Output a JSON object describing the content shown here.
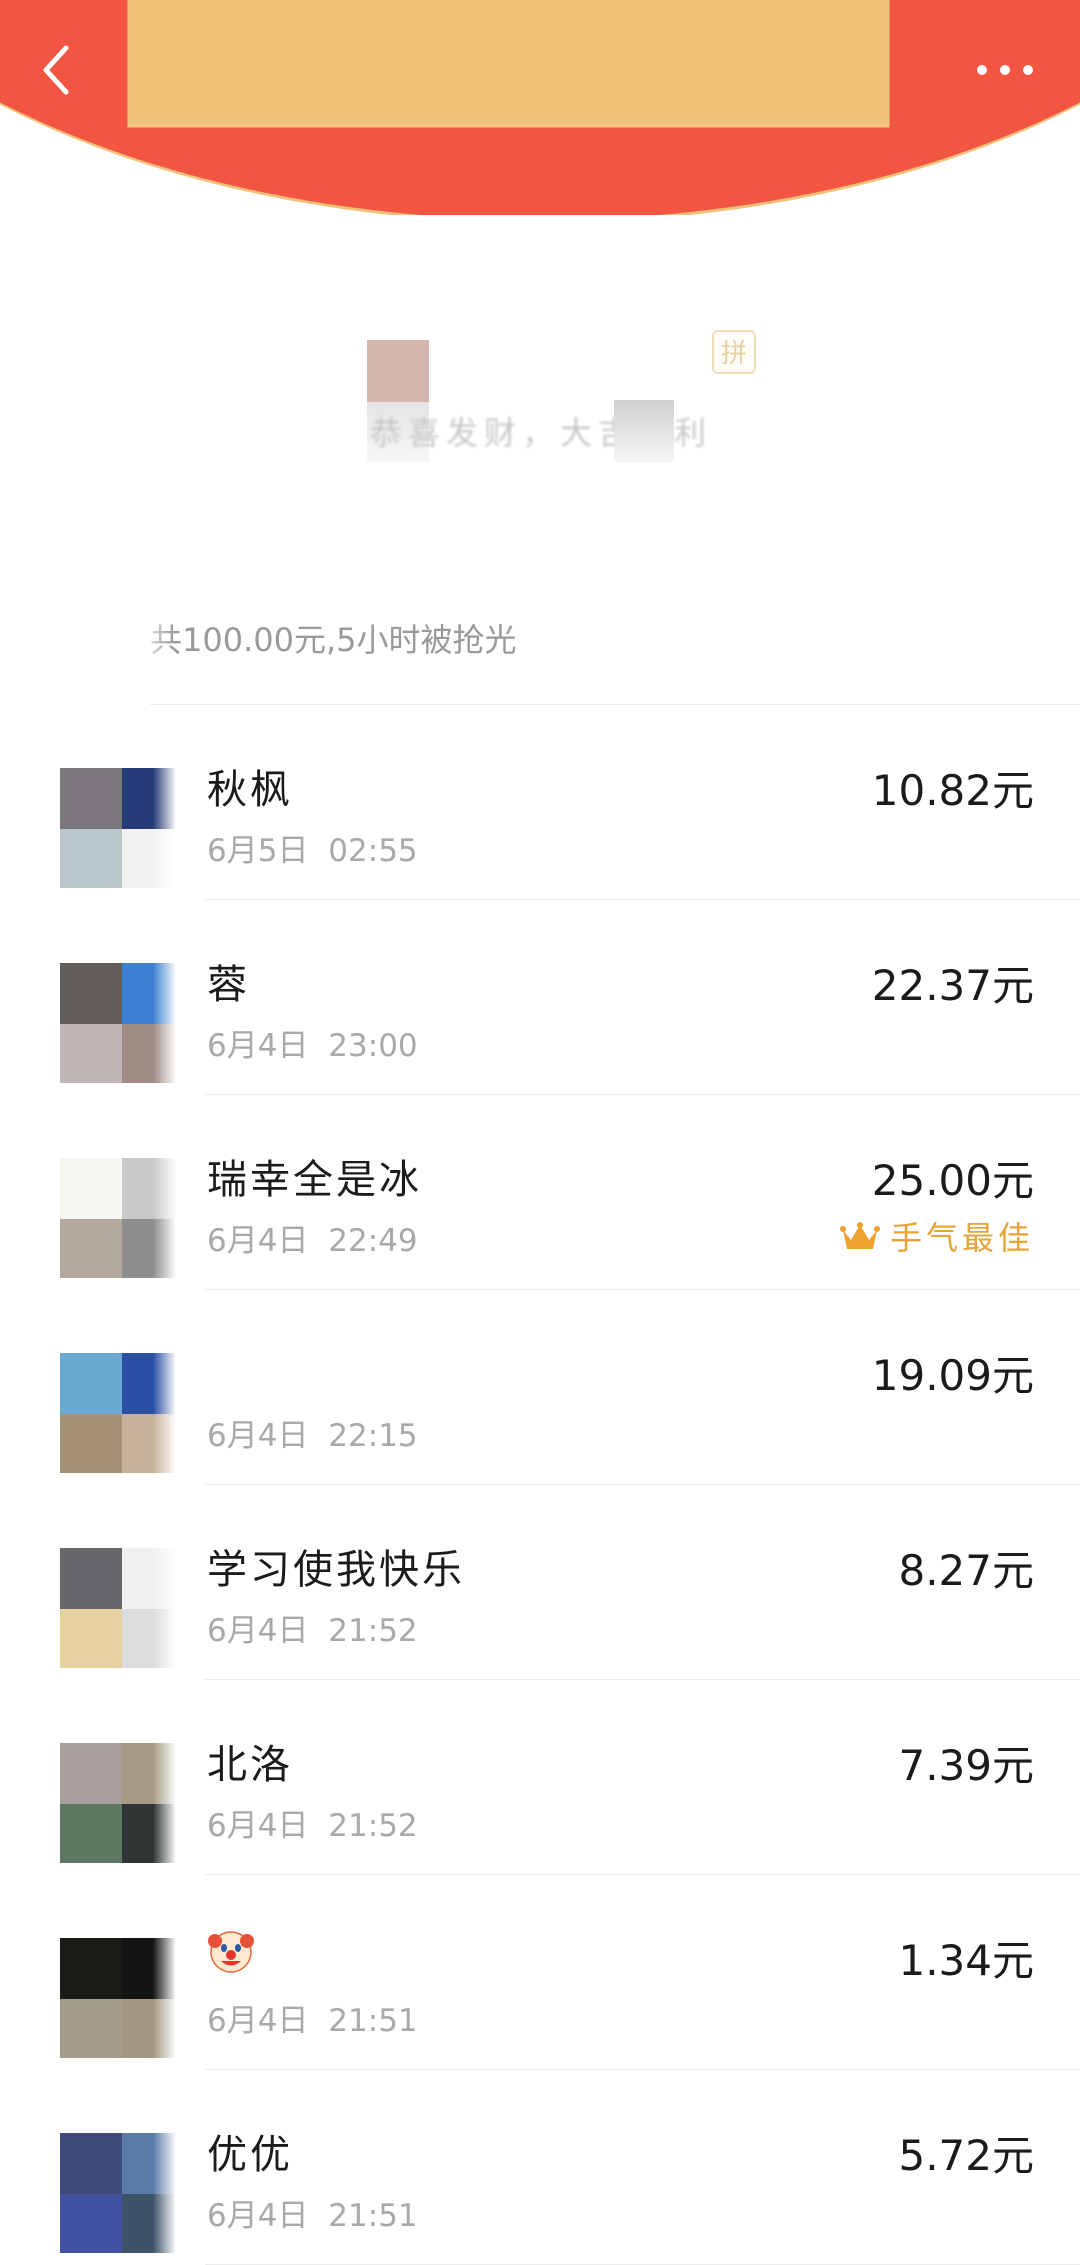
{
  "header": {
    "accent_color": "#F35543",
    "back_icon": "chevron-left-icon",
    "more_icon": "more-horizontal-icon"
  },
  "sender": {
    "badge": "拼",
    "greeting": "恭喜发财，大吉大利"
  },
  "summary": "共100.00元,5小时被抢光",
  "best_label": "手气最佳",
  "best_color": "#E8A236",
  "records": [
    {
      "name": "秋枫",
      "time": "6月5日 02:55",
      "amount": "10.82元",
      "avatar_colors": [
        "#7b777d",
        "#253c78",
        "#b9c7ca",
        "#f2f2f2"
      ]
    },
    {
      "name": "蓉",
      "time": "6月4日 23:00",
      "amount": "22.37元",
      "avatar_colors": [
        "#625e5b",
        "#3b80d3",
        "#c0b7b6",
        "#a18b85"
      ]
    },
    {
      "name": "瑞幸全是冰",
      "time": "6月4日 22:49",
      "amount": "25.00元",
      "best": true,
      "avatar_colors": [
        "#f6f7f1",
        "#c9c9c9",
        "#b3a89c",
        "#8e8e8e"
      ]
    },
    {
      "name": "",
      "time": "6月4日 22:15",
      "amount": "19.09元",
      "avatar_colors": [
        "#6aa9d2",
        "#2c4fa6",
        "#a59275",
        "#c6b29c"
      ]
    },
    {
      "name": "学习使我快乐",
      "time": "6月4日 21:52",
      "amount": "8.27元",
      "avatar_colors": [
        "#69666b",
        "#f0f0f0",
        "#e6d2a0",
        "#dcdcdc"
      ]
    },
    {
      "name": "北洛",
      "time": "6月4日 21:52",
      "amount": "7.39元",
      "avatar_colors": [
        "#a99f9c",
        "#a69b85",
        "#5d7860",
        "#2f3534"
      ]
    },
    {
      "name": "",
      "name_icon": "clown-face-icon",
      "time": "6月4日 21:51",
      "amount": "1.34元",
      "avatar_colors": [
        "#1a1c17",
        "#141414",
        "#a49d8d",
        "#a39781"
      ]
    },
    {
      "name": "优优",
      "time": "6月4日 21:51",
      "amount": "5.72元",
      "avatar_colors": [
        "#404b79",
        "#5b7aa8",
        "#4252a0",
        "#3d536a"
      ]
    }
  ]
}
